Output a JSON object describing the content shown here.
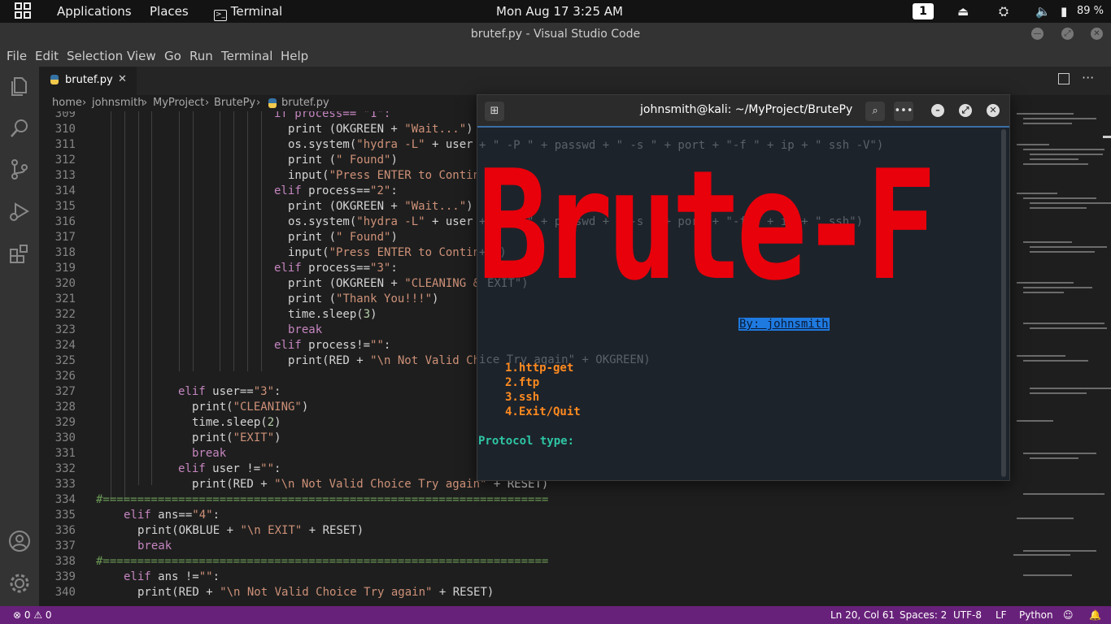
{
  "topbar": {
    "applications": "Applications",
    "places": "Places",
    "terminal": "Terminal",
    "datetime": "Mon Aug 17  3:25 AM",
    "workspace": "1",
    "battery": "89 %"
  },
  "window_title": "brutef.py - Visual Studio Code",
  "menu": [
    "File",
    "Edit",
    "Selection",
    "View",
    "Go",
    "Run",
    "Terminal",
    "Help"
  ],
  "tab": {
    "label": "brutef.py"
  },
  "breadcrumb": [
    "home",
    "johnsmith",
    "MyProject",
    "BrutePy",
    "brutef.py"
  ],
  "code_lines": [
    {
      "n": "309",
      "t": ""
    },
    {
      "n": "310",
      "t": ""
    },
    {
      "n": "311",
      "t": ""
    },
    {
      "n": "312",
      "t": ""
    },
    {
      "n": "313",
      "t": ""
    },
    {
      "n": "314",
      "t": ""
    },
    {
      "n": "315",
      "t": ""
    },
    {
      "n": "316",
      "t": ""
    },
    {
      "n": "317",
      "t": ""
    },
    {
      "n": "318",
      "t": ""
    },
    {
      "n": "319",
      "t": ""
    },
    {
      "n": "320",
      "t": ""
    },
    {
      "n": "321",
      "t": ""
    },
    {
      "n": "322",
      "t": ""
    },
    {
      "n": "323",
      "t": ""
    },
    {
      "n": "324",
      "t": ""
    },
    {
      "n": "325",
      "t": ""
    },
    {
      "n": "326",
      "t": ""
    },
    {
      "n": "327",
      "t": ""
    },
    {
      "n": "328",
      "t": ""
    },
    {
      "n": "329",
      "t": ""
    },
    {
      "n": "330",
      "t": ""
    },
    {
      "n": "331",
      "t": ""
    },
    {
      "n": "332",
      "t": ""
    },
    {
      "n": "333",
      "t": ""
    },
    {
      "n": "334",
      "t": ""
    },
    {
      "n": "335",
      "t": ""
    },
    {
      "n": "336",
      "t": ""
    },
    {
      "n": "337",
      "t": ""
    },
    {
      "n": "338",
      "t": ""
    },
    {
      "n": "339",
      "t": ""
    },
    {
      "n": "340",
      "t": ""
    }
  ],
  "code": {
    "l309": "if process== \"1\":",
    "l310a": "print (OKGREEN + ",
    "l310b": "\"Wait...\"",
    "l310c": ")",
    "l311a": "os.system(",
    "l311b": "\"hydra -L\"",
    "l311c": " + user",
    "l312a": "print (",
    "l312b": "\" Found\"",
    "l312c": ")",
    "l313a": "input(",
    "l313b": "\"Press ENTER to Continu",
    "l314a": "elif",
    "l314b": " process==",
    "l314c": "\"2\"",
    "l314d": ":",
    "l315a": "print (OKGREEN + ",
    "l315b": "\"Wait...\"",
    "l315c": ")",
    "l316a": "os.system(",
    "l316b": "\"hydra -L\"",
    "l316c": " + user",
    "l317a": "print (",
    "l317b": "\" Found\"",
    "l317c": ")",
    "l318a": "input(",
    "l318b": "\"Press ENTER to Continu",
    "l319a": "elif",
    "l319b": " process==",
    "l319c": "\"3\"",
    "l319d": ":",
    "l320a": "print (OKGREEN + ",
    "l320b": "\"CLEANING & ",
    "l321a": "print (",
    "l321b": "\"Thank You!!!\"",
    "l321c": ")",
    "l322a": "time.sleep(",
    "l322b": "3",
    "l322c": ")",
    "l323": "break",
    "l324a": "elif",
    "l324b": " process!=",
    "l324c": "\"\"",
    "l324d": ":",
    "l325a": "print(RED + ",
    "l325b": "\"\\n Not Valid Cho",
    "l327a": "elif",
    "l327b": " user==",
    "l327c": "\"3\"",
    "l327d": ":",
    "l328a": "print(",
    "l328b": "\"CLEANING\"",
    "l328c": ")",
    "l329a": "time.sleep(",
    "l329b": "2",
    "l329c": ")",
    "l330a": "print(",
    "l330b": "\"EXIT\"",
    "l330c": ")",
    "l331": "break",
    "l332a": "elif",
    "l332b": " user !=",
    "l332c": "\"\"",
    "l332d": ":",
    "l333a": "print(RED + ",
    "l333b": "\"\\n Not Valid Choice Try again\"",
    "l333c": " + RESET)",
    "l334": "#=================================================================",
    "l335a": "elif",
    "l335b": " ans==",
    "l335c": "\"4\"",
    "l335d": ":",
    "l336a": "print(OKBLUE + ",
    "l336b": "\"\\n EXIT\"",
    "l336c": " + RESET)",
    "l337": "break",
    "l338": "#=================================================================",
    "l339a": "elif",
    "l339b": " ans !=",
    "l339c": "\"\"",
    "l339d": ":",
    "l340a": "print(RED + ",
    "l340b": "\"\\n Not Valid Choice Try again\"",
    "l340c": " + RESET)"
  },
  "terminal": {
    "title": "johnsmith@kali: ~/MyProject/BrutePy",
    "ghost1": "+ \" -P \" + passwd + \" -s \" + port + \"-f \" + ip + \" ssh -V\")",
    "ghost2": "+ \" -P \" + passwd + \" -s \" + port + \"-f \" + ip + \" ssh\")",
    "ghost3": "+ \")",
    "ghost4": "EXIT\")",
    "ghost5": "ice Try again\" + OKGREEN)",
    "banner": "Brute-F",
    "author": "By: johnsmith",
    "options": [
      "1.http-get",
      "2.ftp",
      "3.ssh",
      "4.Exit/Quit"
    ],
    "prompt": "Protocol type:"
  },
  "status": {
    "problems": "⊗ 0 ⚠ 0",
    "position": "Ln 20, Col 61",
    "spaces": "Spaces: 2",
    "encoding": "UTF-8",
    "eol": "LF",
    "language": "Python"
  },
  "colors": {
    "banner": "#e8000b",
    "options": "#ff8a1f",
    "prompt": "#2ec5a4",
    "author_bg": "#1f7ae0",
    "statusbar": "#68217a"
  }
}
